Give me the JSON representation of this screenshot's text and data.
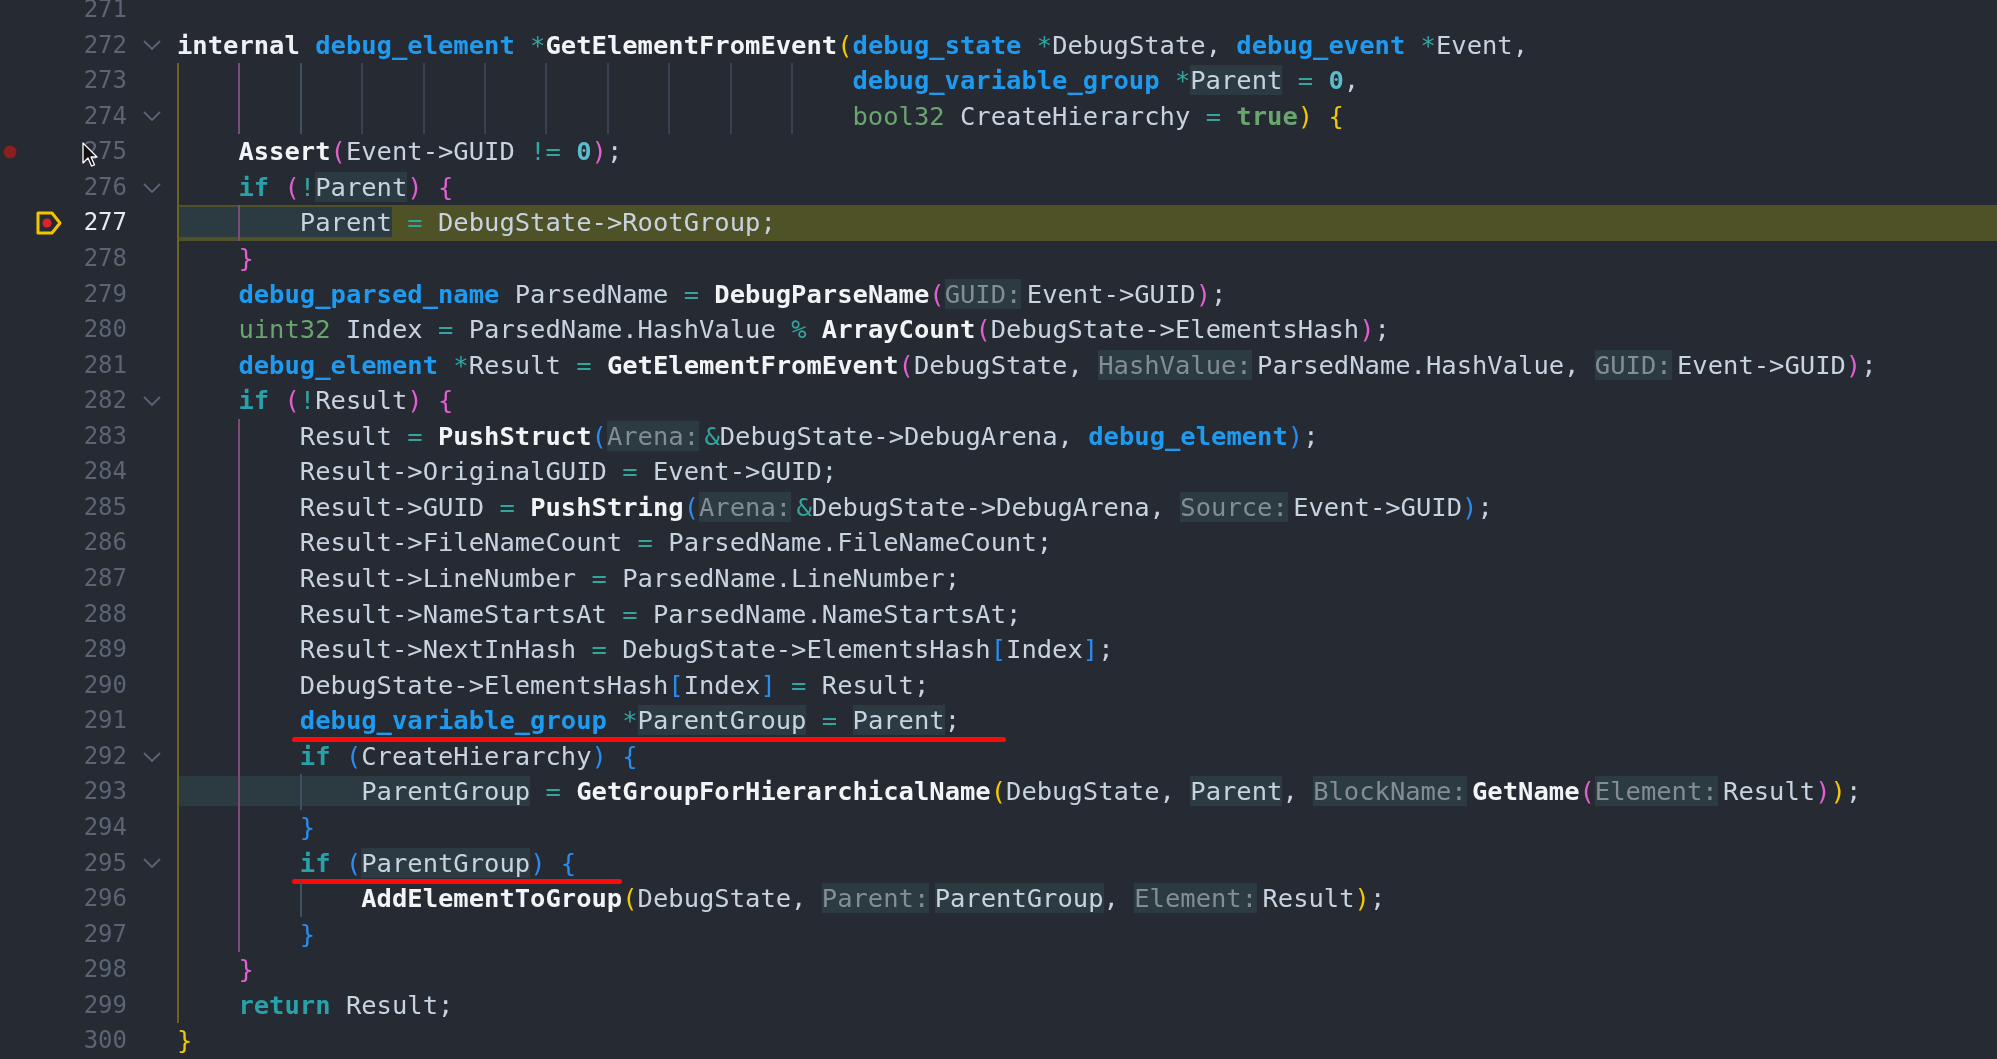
{
  "editor": {
    "lines": [
      {
        "number": "271",
        "fold": false,
        "underline": false
      },
      {
        "number": "272",
        "fold": true,
        "underline": false,
        "tokens": [
          {
            "kind": "keyword",
            "text": "internal "
          },
          {
            "kind": "type",
            "text": "debug_element "
          },
          {
            "kind": "op",
            "text": "*"
          },
          {
            "kind": "function",
            "text": "GetElementFromEvent"
          },
          {
            "kind": "paren1",
            "text": "("
          },
          {
            "kind": "type",
            "text": "debug_state "
          },
          {
            "kind": "op",
            "text": "*"
          },
          {
            "kind": "ident",
            "text": "DebugState, "
          },
          {
            "kind": "type",
            "text": "debug_event "
          },
          {
            "kind": "op",
            "text": "*"
          },
          {
            "kind": "ident",
            "text": "Event,"
          }
        ]
      },
      {
        "number": "273",
        "fold": false,
        "underline": false,
        "tokens": [
          {
            "kind": "type",
            "text": "                                            debug_variable_group "
          },
          {
            "kind": "op",
            "text": "*"
          },
          {
            "kind": "ref",
            "text": "Parent"
          },
          {
            "kind": "op",
            "text": " = "
          },
          {
            "kind": "number",
            "text": "0"
          },
          {
            "kind": "ident",
            "text": ","
          }
        ]
      },
      {
        "number": "274",
        "fold": true,
        "underline": false,
        "tokens": [
          {
            "kind": "primitive",
            "text": "                                            bool32"
          },
          {
            "kind": "ident",
            "text": " CreateHierarchy "
          },
          {
            "kind": "op",
            "text": "= "
          },
          {
            "kind": "literal",
            "text": "true"
          },
          {
            "kind": "paren1",
            "text": ") {"
          }
        ]
      },
      {
        "number": "275",
        "fold": false,
        "underline": false,
        "breakpoint": true,
        "current": false,
        "tokens": [
          {
            "kind": "function",
            "text": "    Assert"
          },
          {
            "kind": "paren2",
            "text": "("
          },
          {
            "kind": "ident",
            "text": "Event->GUID "
          },
          {
            "kind": "op",
            "text": "!= "
          },
          {
            "kind": "number",
            "text": "0"
          },
          {
            "kind": "paren2",
            "text": ")"
          },
          {
            "kind": "ident",
            "text": ";"
          }
        ]
      },
      {
        "number": "276",
        "fold": true,
        "underline": false,
        "tokens": [
          {
            "kind": "control",
            "text": "    if "
          },
          {
            "kind": "paren2",
            "text": "("
          },
          {
            "kind": "op",
            "text": "!"
          },
          {
            "kind": "ref",
            "text": "Parent"
          },
          {
            "kind": "paren2",
            "text": ") {"
          }
        ]
      },
      {
        "number": "277",
        "fold": false,
        "underline": false,
        "breakpoint": false,
        "current": true,
        "tokens": [
          {
            "kind": "ref",
            "text": "        Parent"
          },
          {
            "kind": "op",
            "text": " = "
          },
          {
            "kind": "ident",
            "text": "DebugState->RootGroup;"
          }
        ]
      },
      {
        "number": "278",
        "fold": false,
        "underline": false,
        "tokens": [
          {
            "kind": "paren2",
            "text": "    }"
          }
        ]
      },
      {
        "number": "279",
        "fold": false,
        "underline": false,
        "tokens": [
          {
            "kind": "type",
            "text": "    debug_parsed_name"
          },
          {
            "kind": "ident",
            "text": " ParsedName "
          },
          {
            "kind": "op",
            "text": "= "
          },
          {
            "kind": "function",
            "text": "DebugParseName"
          },
          {
            "kind": "paren2",
            "text": "("
          },
          {
            "kind": "hint",
            "text": "GUID:"
          },
          {
            "kind": "ident",
            "text": "Event->GUID"
          },
          {
            "kind": "paren2",
            "text": ")"
          },
          {
            "kind": "ident",
            "text": ";"
          }
        ]
      },
      {
        "number": "280",
        "fold": false,
        "underline": false,
        "tokens": [
          {
            "kind": "primitive",
            "text": "    uint32"
          },
          {
            "kind": "ident",
            "text": " Index "
          },
          {
            "kind": "op",
            "text": "="
          },
          {
            "kind": "ident",
            "text": " ParsedName.HashValue "
          },
          {
            "kind": "op",
            "text": "% "
          },
          {
            "kind": "function",
            "text": "ArrayCount"
          },
          {
            "kind": "paren2",
            "text": "("
          },
          {
            "kind": "ident",
            "text": "DebugState->ElementsHash"
          },
          {
            "kind": "paren2",
            "text": ")"
          },
          {
            "kind": "ident",
            "text": ";"
          }
        ]
      },
      {
        "number": "281",
        "fold": false,
        "underline": false,
        "tokens": [
          {
            "kind": "type",
            "text": "    debug_element "
          },
          {
            "kind": "op",
            "text": "*"
          },
          {
            "kind": "ident",
            "text": "Result "
          },
          {
            "kind": "op",
            "text": "= "
          },
          {
            "kind": "function",
            "text": "GetElementFromEvent"
          },
          {
            "kind": "paren2",
            "text": "("
          },
          {
            "kind": "ident",
            "text": "DebugState, "
          },
          {
            "kind": "hint",
            "text": "HashValue:"
          },
          {
            "kind": "ident",
            "text": "ParsedName.HashValue, "
          },
          {
            "kind": "hint",
            "text": "GUID:"
          },
          {
            "kind": "ident",
            "text": "Event->GUID"
          },
          {
            "kind": "paren2",
            "text": ")"
          },
          {
            "kind": "ident",
            "text": ";"
          }
        ]
      },
      {
        "number": "282",
        "fold": true,
        "underline": false,
        "tokens": [
          {
            "kind": "control",
            "text": "    if "
          },
          {
            "kind": "paren2",
            "text": "("
          },
          {
            "kind": "op",
            "text": "!"
          },
          {
            "kind": "ident",
            "text": "Result"
          },
          {
            "kind": "paren2",
            "text": ") {"
          }
        ]
      },
      {
        "number": "283",
        "fold": false,
        "underline": false,
        "tokens": [
          {
            "kind": "ident",
            "text": "        Result "
          },
          {
            "kind": "op",
            "text": "= "
          },
          {
            "kind": "function",
            "text": "PushStruct"
          },
          {
            "kind": "paren3",
            "text": "("
          },
          {
            "kind": "hint",
            "text": "Arena:"
          },
          {
            "kind": "op",
            "text": "&"
          },
          {
            "kind": "ident",
            "text": "DebugState->DebugArena, "
          },
          {
            "kind": "type",
            "text": "debug_element"
          },
          {
            "kind": "paren3",
            "text": ")"
          },
          {
            "kind": "ident",
            "text": ";"
          }
        ]
      },
      {
        "number": "284",
        "fold": false,
        "underline": false,
        "tokens": [
          {
            "kind": "ident",
            "text": "        Result->OriginalGUID "
          },
          {
            "kind": "op",
            "text": "="
          },
          {
            "kind": "ident",
            "text": " Event->GUID;"
          }
        ]
      },
      {
        "number": "285",
        "fold": false,
        "underline": false,
        "tokens": [
          {
            "kind": "ident",
            "text": "        Result->GUID "
          },
          {
            "kind": "op",
            "text": "= "
          },
          {
            "kind": "function",
            "text": "PushString"
          },
          {
            "kind": "paren3",
            "text": "("
          },
          {
            "kind": "hint",
            "text": "Arena:"
          },
          {
            "kind": "op",
            "text": "&"
          },
          {
            "kind": "ident",
            "text": "DebugState->DebugArena, "
          },
          {
            "kind": "hint",
            "text": "Source:"
          },
          {
            "kind": "ident",
            "text": "Event->GUID"
          },
          {
            "kind": "paren3",
            "text": ")"
          },
          {
            "kind": "ident",
            "text": ";"
          }
        ]
      },
      {
        "number": "286",
        "fold": false,
        "underline": false,
        "tokens": [
          {
            "kind": "ident",
            "text": "        Result->FileNameCount "
          },
          {
            "kind": "op",
            "text": "="
          },
          {
            "kind": "ident",
            "text": " ParsedName.FileNameCount;"
          }
        ]
      },
      {
        "number": "287",
        "fold": false,
        "underline": false,
        "tokens": [
          {
            "kind": "ident",
            "text": "        Result->LineNumber "
          },
          {
            "kind": "op",
            "text": "="
          },
          {
            "kind": "ident",
            "text": " ParsedName.LineNumber;"
          }
        ]
      },
      {
        "number": "288",
        "fold": false,
        "underline": false,
        "tokens": [
          {
            "kind": "ident",
            "text": "        Result->NameStartsAt "
          },
          {
            "kind": "op",
            "text": "="
          },
          {
            "kind": "ident",
            "text": " ParsedName.NameStartsAt;"
          }
        ]
      },
      {
        "number": "289",
        "fold": false,
        "underline": false,
        "tokens": [
          {
            "kind": "ident",
            "text": "        Result->NextInHash "
          },
          {
            "kind": "op",
            "text": "="
          },
          {
            "kind": "ident",
            "text": " DebugState->ElementsHash"
          },
          {
            "kind": "paren3",
            "text": "["
          },
          {
            "kind": "ident",
            "text": "Index"
          },
          {
            "kind": "paren3",
            "text": "]"
          },
          {
            "kind": "ident",
            "text": ";"
          }
        ]
      },
      {
        "number": "290",
        "fold": false,
        "underline": false,
        "tokens": [
          {
            "kind": "ident",
            "text": "        DebugState->ElementsHash"
          },
          {
            "kind": "paren3",
            "text": "["
          },
          {
            "kind": "ident",
            "text": "Index"
          },
          {
            "kind": "paren3",
            "text": "]"
          },
          {
            "kind": "op",
            "text": " ="
          },
          {
            "kind": "ident",
            "text": " Result;"
          }
        ]
      },
      {
        "number": "291",
        "fold": false,
        "underline": true,
        "tokens": [
          {
            "kind": "type",
            "text": "        debug_variable_group "
          },
          {
            "kind": "op",
            "text": "*"
          },
          {
            "kind": "ref",
            "text": "ParentGroup"
          },
          {
            "kind": "op",
            "text": " = "
          },
          {
            "kind": "ref",
            "text": "Parent"
          },
          {
            "kind": "ident",
            "text": ";"
          }
        ]
      },
      {
        "number": "292",
        "fold": true,
        "underline": false,
        "tokens": [
          {
            "kind": "control",
            "text": "        if "
          },
          {
            "kind": "paren3",
            "text": "("
          },
          {
            "kind": "ident",
            "text": "CreateHierarchy"
          },
          {
            "kind": "paren3",
            "text": ") {"
          }
        ]
      },
      {
        "number": "293",
        "fold": false,
        "underline": false,
        "tokens": [
          {
            "kind": "ref",
            "text": "            ParentGroup"
          },
          {
            "kind": "op",
            "text": " = "
          },
          {
            "kind": "function",
            "text": "GetGroupForHierarchicalName"
          },
          {
            "kind": "paren1",
            "text": "("
          },
          {
            "kind": "ident",
            "text": "DebugState, "
          },
          {
            "kind": "ref",
            "text": "Parent"
          },
          {
            "kind": "ident",
            "text": ", "
          },
          {
            "kind": "hint",
            "text": "BlockName:"
          },
          {
            "kind": "function",
            "text": "GetName"
          },
          {
            "kind": "paren2",
            "text": "("
          },
          {
            "kind": "hint",
            "text": "Element:"
          },
          {
            "kind": "ident",
            "text": "Result"
          },
          {
            "kind": "paren2",
            "text": ")"
          },
          {
            "kind": "paren1",
            "text": ")"
          },
          {
            "kind": "ident",
            "text": ";"
          }
        ]
      },
      {
        "number": "294",
        "fold": false,
        "underline": false,
        "tokens": [
          {
            "kind": "paren3",
            "text": "        }"
          }
        ]
      },
      {
        "number": "295",
        "fold": true,
        "underline": true,
        "tokens": [
          {
            "kind": "control",
            "text": "        if "
          },
          {
            "kind": "paren3",
            "text": "("
          },
          {
            "kind": "ref",
            "text": "ParentGroup"
          },
          {
            "kind": "paren3",
            "text": ") {"
          }
        ]
      },
      {
        "number": "296",
        "fold": false,
        "underline": false,
        "tokens": [
          {
            "kind": "function",
            "text": "            AddElementToGroup"
          },
          {
            "kind": "paren1",
            "text": "("
          },
          {
            "kind": "ident",
            "text": "DebugState, "
          },
          {
            "kind": "hint",
            "text": "Parent:"
          },
          {
            "kind": "ref",
            "text": "ParentGroup"
          },
          {
            "kind": "ident",
            "text": ", "
          },
          {
            "kind": "hint",
            "text": "Element:"
          },
          {
            "kind": "ident",
            "text": "Result"
          },
          {
            "kind": "paren1",
            "text": ")"
          },
          {
            "kind": "ident",
            "text": ";"
          }
        ]
      },
      {
        "number": "297",
        "fold": false,
        "underline": false,
        "tokens": [
          {
            "kind": "paren3",
            "text": "        }"
          }
        ]
      },
      {
        "number": "298",
        "fold": false,
        "underline": false,
        "tokens": [
          {
            "kind": "paren2",
            "text": "    }"
          }
        ]
      },
      {
        "number": "299",
        "fold": false,
        "underline": false,
        "tokens": [
          {
            "kind": "control",
            "text": "    return"
          },
          {
            "kind": "ident",
            "text": " Result;"
          }
        ]
      },
      {
        "number": "300",
        "fold": false,
        "underline": false,
        "tokens": [
          {
            "kind": "paren1",
            "text": "}"
          }
        ]
      }
    ]
  }
}
